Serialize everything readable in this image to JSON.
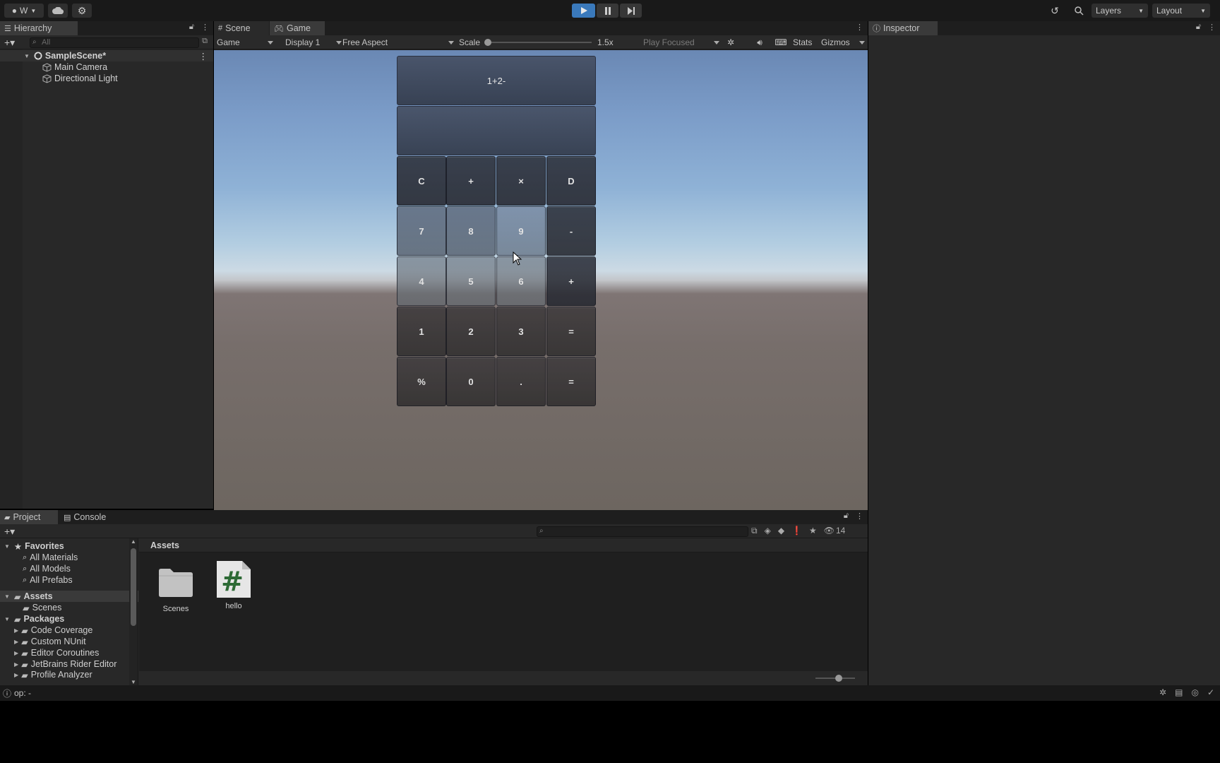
{
  "toolbar": {
    "account_label": "W",
    "layers_label": "Layers",
    "layout_label": "Layout"
  },
  "hierarchy": {
    "tab_label": "Hierarchy",
    "search_placeholder": "All",
    "scene_name": "SampleScene*",
    "items": [
      {
        "label": "Main Camera"
      },
      {
        "label": "Directional Light"
      }
    ]
  },
  "scene_tab": {
    "label": "Scene"
  },
  "game_tab": {
    "label": "Game"
  },
  "game_bar": {
    "mode": "Game",
    "display": "Display 1",
    "aspect": "Free Aspect",
    "scale_label": "Scale",
    "scale_value": "1.5x",
    "play_focused": "Play Focused",
    "stats": "Stats",
    "gizmos": "Gizmos"
  },
  "calculator": {
    "expression": "1+2-",
    "result": "",
    "keys": [
      [
        "C",
        "+",
        "×",
        "D"
      ],
      [
        "7",
        "8",
        "9",
        "-"
      ],
      [
        "4",
        "5",
        "6",
        "+"
      ],
      [
        "1",
        "2",
        "3",
        "="
      ],
      [
        "%",
        "0",
        ".",
        "="
      ]
    ]
  },
  "inspector": {
    "tab_label": "Inspector"
  },
  "project": {
    "tab_label": "Project",
    "console_label": "Console",
    "hidden_count": "14",
    "favorites": {
      "label": "Favorites",
      "items": [
        "All Materials",
        "All Models",
        "All Prefabs"
      ]
    },
    "assets_label": "Assets",
    "assets_children": [
      "Scenes"
    ],
    "packages_label": "Packages",
    "packages": [
      "Code Coverage",
      "Custom NUnit",
      "Editor Coroutines",
      "JetBrains Rider Editor",
      "Profile Analyzer"
    ],
    "breadcrumb": "Assets",
    "asset_items": [
      {
        "label": "Scenes",
        "kind": "folder"
      },
      {
        "label": "hello",
        "kind": "csharp-script"
      }
    ]
  },
  "status": {
    "message": "op: -"
  }
}
